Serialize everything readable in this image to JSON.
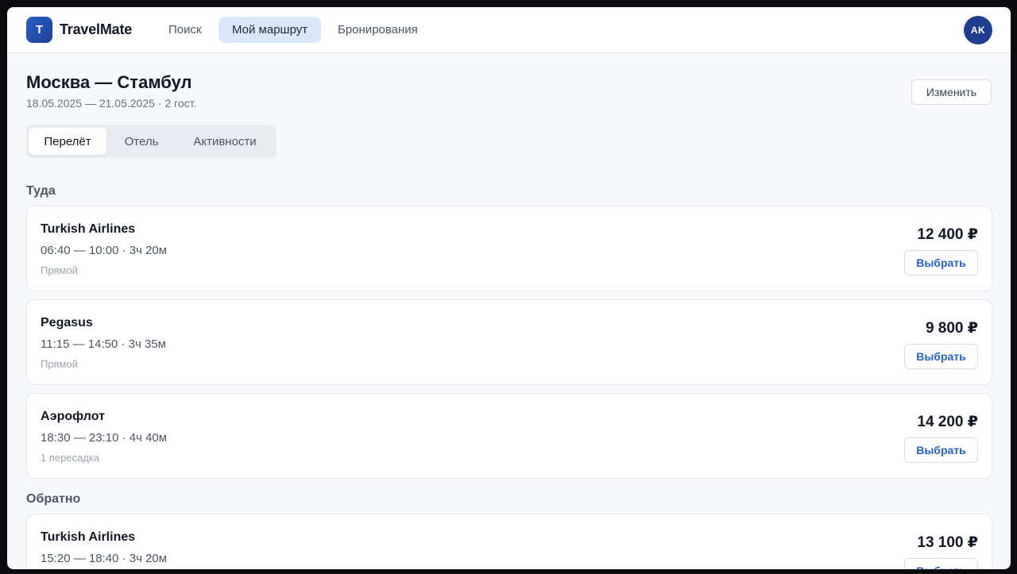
{
  "app": {
    "logo_letter": "T",
    "name": "TravelMate"
  },
  "nav": [
    {
      "label": "Поиск"
    },
    {
      "label": "Мой маршрут",
      "active": true
    },
    {
      "label": "Бронирования"
    }
  ],
  "user": {
    "initials": "AK"
  },
  "trip": {
    "title": "Москва — Стамбул",
    "subtitle": "18.05.2025 — 21.05.2025 · 2 гост.",
    "edit_label": "Изменить"
  },
  "tabs": [
    {
      "label": "Перелёт",
      "active": true
    },
    {
      "label": "Отель"
    },
    {
      "label": "Активности"
    }
  ],
  "outbound": {
    "label": "Туда",
    "flights": [
      {
        "airline": "Turkish Airlines",
        "times": "06:40 — 10:00 · 3ч 20м",
        "stops": "Прямой",
        "price": "12 400 ₽",
        "action": "Выбрать"
      },
      {
        "airline": "Pegasus",
        "times": "11:15 — 14:50 · 3ч 35м",
        "stops": "Прямой",
        "price": "9 800 ₽",
        "action": "Выбрать"
      },
      {
        "airline": "Аэрофлот",
        "times": "18:30 — 23:10 · 4ч 40м",
        "stops": "1 пересадка",
        "price": "14 200 ₽",
        "action": "Выбрать"
      }
    ]
  },
  "return": {
    "label": "Обратно",
    "flights": [
      {
        "airline": "Turkish Airlines",
        "times": "15:20 — 18:40 · 3ч 20м",
        "price": "13 100 ₽",
        "action": "Выбрать"
      }
    ]
  },
  "colors": {
    "accent": "#2563c9",
    "brand": "#1e3f8f",
    "active_nav_bg": "#dbe8fb"
  }
}
